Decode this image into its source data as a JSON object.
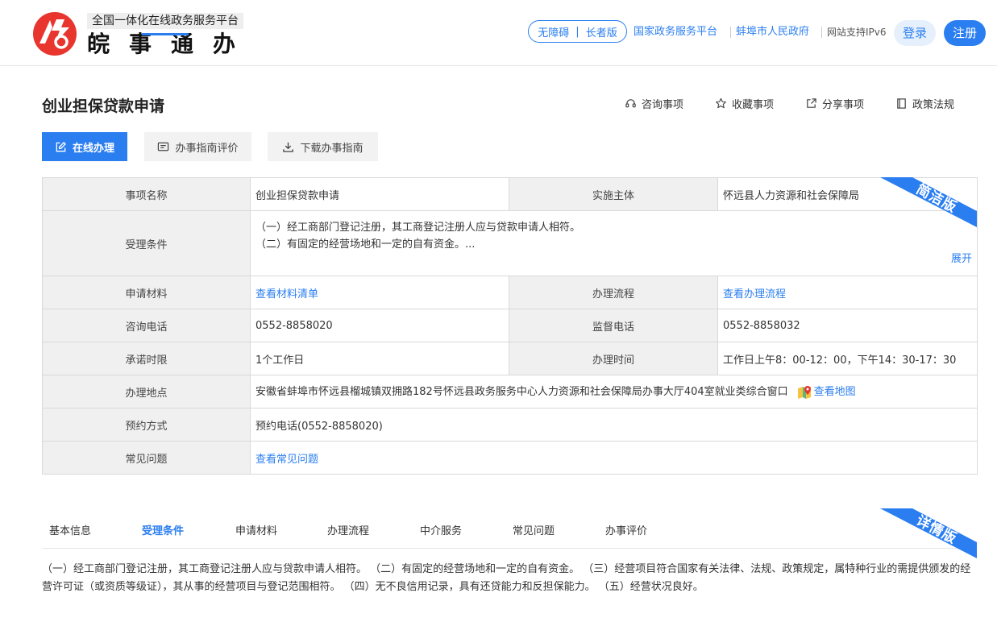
{
  "header": {
    "logo_sub": "全国一体化在线政务服务平台",
    "logo_main": "皖事通办",
    "accessibility": "无障碍",
    "elder": "长者版",
    "links": [
      "国家政务服务平台",
      "蚌埠市人民政府"
    ],
    "ipv6": "网站支持IPv6",
    "login": "登录",
    "register": "注册",
    "brand_color": "#e8352e",
    "accent_color": "#2a7ef0"
  },
  "page": {
    "title": "创业担保贷款申请",
    "actions": {
      "consult": "咨询事项",
      "favorite": "收藏事项",
      "share": "分享事项",
      "policy": "政策法规"
    },
    "buttons": {
      "online": "在线办理",
      "evaluate": "办事指南评价",
      "download": "下载办事指南"
    }
  },
  "info": {
    "ribbon": "简洁版",
    "name_label": "事项名称",
    "name_value": "创业担保贷款申请",
    "subject_label": "实施主体",
    "subject_value": "怀远县人力资源和社会保障局",
    "cond_label": "受理条件",
    "cond_line1": "（一）经工商部门登记注册，其工商登记注册人应与贷款申请人相符。",
    "cond_line2": "（二）有固定的经营场地和一定的自有资金。...",
    "expand": "展开",
    "material_label": "申请材料",
    "material_link": "查看材料清单",
    "flow_label": "办理流程",
    "flow_link": "查看办理流程",
    "phone_label": "咨询电话",
    "phone_value": "0552-8858020",
    "supervise_label": "监督电话",
    "supervise_value": "0552-8858032",
    "limit_label": "承诺时限",
    "limit_value": "1个工作日",
    "time_label": "办理时间",
    "time_value": "工作日上午8：00-12：00，下午14：30-17：30",
    "address_label": "办理地点",
    "address_value": "安徽省蚌埠市怀远县榴城镇双拥路182号怀远县政务服务中心人力资源和社会保障局办事大厅404室就业类综合窗口",
    "map_link": "查看地图",
    "booking_label": "预约方式",
    "booking_value": "预约电话(0552-8858020)",
    "faq_label": "常见问题",
    "faq_link": "查看常见问题"
  },
  "tabs": {
    "ribbon": "详情版",
    "items": [
      "基本信息",
      "受理条件",
      "申请材料",
      "办理流程",
      "中介服务",
      "常见问题",
      "办事评价"
    ],
    "active": "受理条件"
  },
  "detail": {
    "text": "（一）经工商部门登记注册，其工商登记注册人应与贷款申请人相符。 （二）有固定的经营场地和一定的自有资金。 （三）经营项目符合国家有关法律、法规、政策规定，属特种行业的需提供颁发的经营许可证（或资质等级证），其从事的经营项目与登记范围相符。 （四）无不良信用记录，具有还贷能力和反担保能力。 （五）经营状况良好。"
  }
}
